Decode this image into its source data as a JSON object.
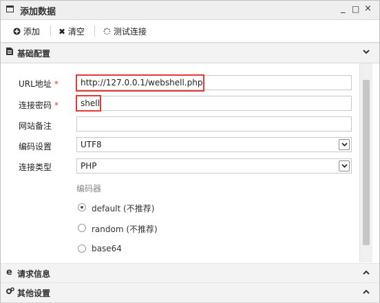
{
  "window": {
    "title": "添加数据",
    "icon": "window-icon",
    "controls": [
      "_",
      "□",
      "×"
    ]
  },
  "toolbar": {
    "add_label": "添加",
    "clear_label": "清空",
    "test_label": "测试连接"
  },
  "panels": {
    "basic": {
      "title": "基础配置",
      "state": "expanded"
    },
    "request": {
      "title": "请求信息",
      "state": "collapsed"
    },
    "other": {
      "title": "其他设置",
      "state": "collapsed"
    }
  },
  "form": {
    "url": {
      "label": "URL地址",
      "required_mark": "*",
      "value": "http://127.0.0.1/webshell.php"
    },
    "password": {
      "label": "连接密码",
      "required_mark": "*",
      "value": "shell"
    },
    "note": {
      "label": "网站备注",
      "value": ""
    },
    "encoding": {
      "label": "编码设置",
      "value": "UTF8"
    },
    "type": {
      "label": "连接类型",
      "value": "PHP"
    },
    "encoder": {
      "label": "编码器",
      "options": [
        {
          "label": "default (不推荐)",
          "selected": true
        },
        {
          "label": "random (不推荐)",
          "selected": false
        },
        {
          "label": "base64",
          "selected": false
        }
      ]
    }
  },
  "colors": {
    "highlight": "#e53935",
    "required": "#e23b3b"
  }
}
